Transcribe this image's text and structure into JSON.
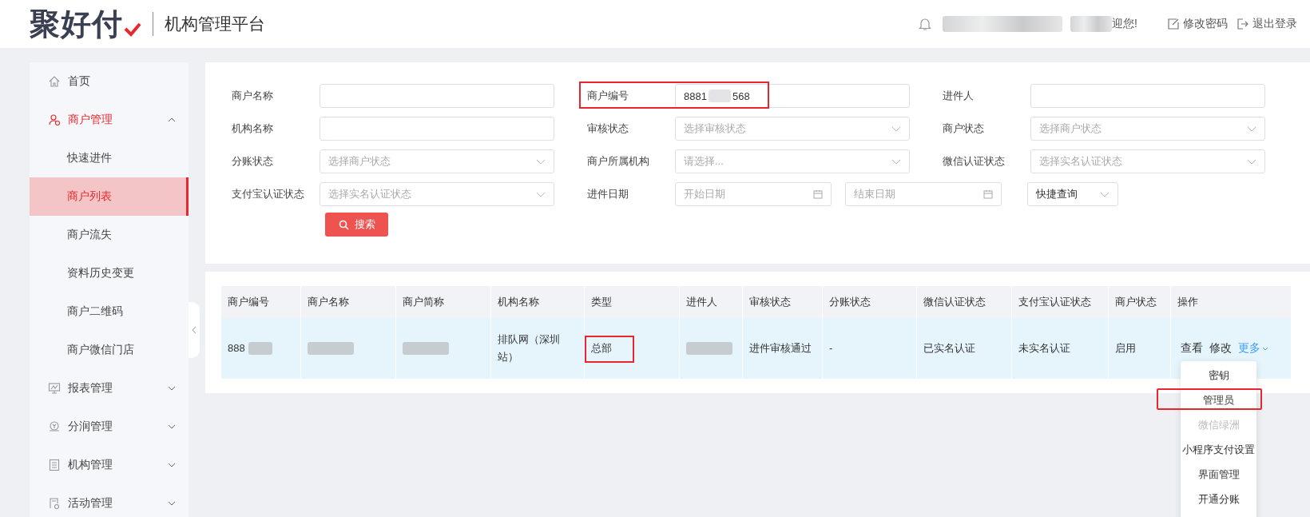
{
  "header": {
    "logo": "聚好付",
    "platform": "机构管理平台",
    "greeting": "迎您!",
    "links": [
      {
        "kind": "edit",
        "label": "修改密码"
      },
      {
        "kind": "logout",
        "label": "退出登录"
      }
    ]
  },
  "sidebar": {
    "items": [
      {
        "label": "首页",
        "selected": false
      },
      {
        "label": "商户管理",
        "selected": true,
        "expanded": true,
        "children": [
          {
            "label": "快速进件",
            "selected": false
          },
          {
            "label": "商户列表",
            "selected": true
          },
          {
            "label": "商户流失",
            "selected": false
          },
          {
            "label": "资料历史变更",
            "selected": false
          },
          {
            "label": "商户二维码",
            "selected": false
          },
          {
            "label": "商户微信门店",
            "selected": false
          }
        ]
      },
      {
        "label": "报表管理",
        "selected": false,
        "expanded": false
      },
      {
        "label": "分润管理",
        "selected": false,
        "expanded": false
      },
      {
        "label": "机构管理",
        "selected": false,
        "expanded": false
      },
      {
        "label": "活动管理",
        "selected": false,
        "expanded": false
      }
    ]
  },
  "filters": [
    [
      {
        "label": "商户名称",
        "kind": "text"
      },
      {
        "label": "商户编号",
        "kind": "text",
        "value_start": "8881",
        "value_end": "568",
        "highlighted": true
      },
      {
        "label": "进件人",
        "kind": "text"
      }
    ],
    [
      {
        "label": "机构名称",
        "kind": "text"
      },
      {
        "label": "审核状态",
        "kind": "select",
        "placeholder": "选择审核状态"
      },
      {
        "label": "商户状态",
        "kind": "select",
        "placeholder": "选择商户状态"
      }
    ],
    [
      {
        "label": "分账状态",
        "kind": "select",
        "placeholder": "选择商户状态"
      },
      {
        "label": "商户所属机构",
        "kind": "select",
        "placeholder": "请选择..."
      },
      {
        "label": "微信认证状态",
        "kind": "select",
        "placeholder": "选择实名认证状态"
      }
    ],
    [
      {
        "label": "支付宝认证状态",
        "kind": "select",
        "placeholder": "选择实名认证状态"
      },
      {
        "label": "进件日期",
        "kind": "daterange",
        "placeholder": "开始日期",
        "placeholder_end": "结束日期",
        "quick": "快捷查询"
      }
    ]
  ],
  "search_button": "搜索",
  "table": {
    "columns": [
      "商户编号",
      "商户名称",
      "商户简称",
      "机构名称",
      "类型",
      "进件人",
      "审核状态",
      "分账状态",
      "微信认证状态",
      "支付宝认证状态",
      "商户状态",
      "操作"
    ],
    "rows": [
      {
        "cells": [
          {
            "text": "888",
            "redacted": true
          },
          {
            "redacted": true
          },
          {
            "redacted": true
          },
          {
            "text": "排队网（深圳站）"
          },
          {
            "text": "总部",
            "highlighted": true
          },
          {
            "redacted": true
          },
          {
            "text": "进件审核通过"
          },
          {
            "text": "-"
          },
          {
            "text": "已实名认证"
          },
          {
            "text": "未实名认证"
          },
          {
            "text": "启用"
          }
        ],
        "actions": [
          "查看",
          "修改"
        ],
        "more": "更多"
      }
    ]
  },
  "menu": [
    {
      "label": "密钥",
      "disabled": false,
      "highlighted": false
    },
    {
      "label": "管理员",
      "disabled": false,
      "highlighted": true
    },
    {
      "label": "微信绿洲",
      "disabled": true,
      "highlighted": false
    },
    {
      "label": "小程序支付设置",
      "disabled": false,
      "highlighted": false
    },
    {
      "label": "界面管理",
      "disabled": false,
      "highlighted": false
    },
    {
      "label": "开通分账",
      "disabled": false,
      "highlighted": false
    }
  ]
}
